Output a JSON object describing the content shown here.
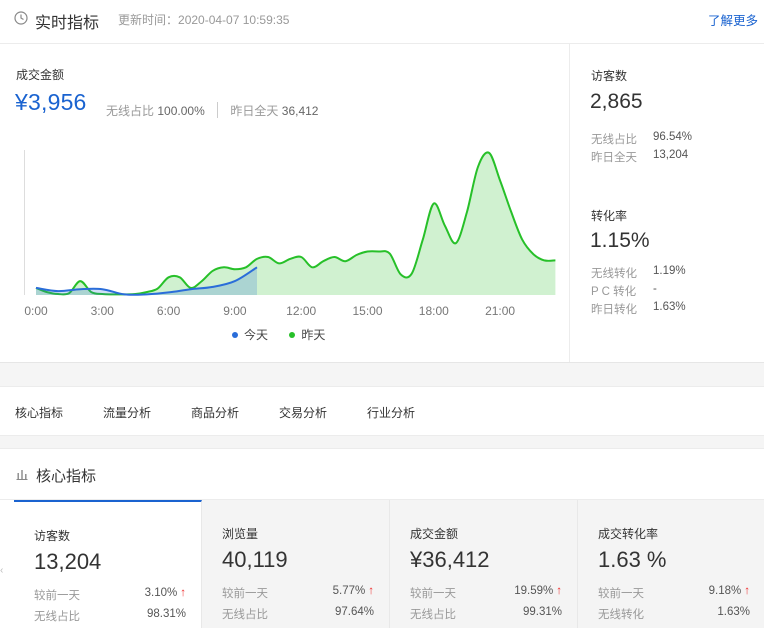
{
  "realtime": {
    "title": "实时指标",
    "update_label": "更新时间：",
    "update_time": "2020-04-07 10:59:35",
    "more_link": "了解更多",
    "gmv": {
      "label": "成交金额",
      "value": "¥3,956",
      "wireless_label": "无线占比",
      "wireless_value": "100.00%",
      "yesterday_label": "昨日全天",
      "yesterday_value": "36,412"
    },
    "visitors": {
      "label": "访客数",
      "value": "2,865",
      "rows": [
        {
          "label": "无线占比",
          "value": "96.54%"
        },
        {
          "label": "昨日全天",
          "value": "13,204"
        }
      ]
    },
    "conversion": {
      "label": "转化率",
      "value": "1.15%",
      "rows": [
        {
          "label": "无线转化",
          "value": "1.19%"
        },
        {
          "label": "P C 转化",
          "value": "-"
        },
        {
          "label": "昨日转化",
          "value": "1.63%"
        }
      ]
    }
  },
  "chart_data": {
    "type": "area",
    "x_ticks": [
      "0:00",
      "3:00",
      "6:00",
      "9:00",
      "12:00",
      "15:00",
      "18:00",
      "21:00"
    ],
    "ylim": [
      0,
      4500
    ],
    "grid": false,
    "legend_position": "bottom",
    "series": [
      {
        "name": "今天",
        "color": "#2a6dd9",
        "x": [
          0,
          1,
          2,
          3,
          4,
          5,
          6,
          7,
          8,
          9,
          10
        ],
        "y": [
          220,
          120,
          180,
          180,
          20,
          20,
          80,
          180,
          250,
          430,
          860
        ]
      },
      {
        "name": "昨天",
        "color": "#27c029",
        "x": [
          0,
          0.5,
          1,
          1.5,
          2,
          2.5,
          3,
          3.5,
          4,
          4.5,
          5,
          5.5,
          6,
          6.5,
          7,
          7.5,
          8,
          8.5,
          9,
          9.5,
          10,
          10.5,
          11,
          11.5,
          12,
          12.5,
          13,
          13.5,
          14,
          14.5,
          15,
          15.5,
          16,
          16.5,
          17,
          17.5,
          18,
          18.5,
          19,
          19.5,
          20,
          20.5,
          21,
          21.5,
          22,
          22.5,
          23,
          23.5
        ],
        "y": [
          220,
          90,
          30,
          60,
          430,
          90,
          30,
          20,
          20,
          30,
          90,
          200,
          550,
          550,
          220,
          430,
          750,
          860,
          800,
          860,
          1120,
          1180,
          980,
          1120,
          1180,
          860,
          1050,
          1180,
          1050,
          1240,
          1350,
          1350,
          1290,
          640,
          660,
          1720,
          2840,
          2150,
          1610,
          2580,
          3980,
          4410,
          3550,
          2580,
          1720,
          1270,
          1075,
          1075
        ]
      }
    ]
  },
  "tabs": [
    "核心指标",
    "流量分析",
    "商品分析",
    "交易分析",
    "行业分析"
  ],
  "core": {
    "title": "核心指标",
    "cards": [
      {
        "label": "访客数",
        "value": "13,204",
        "cmp_label": "较前一天",
        "cmp_value": "3.10%",
        "share_label": "无线占比",
        "share_value": "98.31%"
      },
      {
        "label": "浏览量",
        "value": "40,119",
        "cmp_label": "较前一天",
        "cmp_value": "5.77%",
        "share_label": "无线占比",
        "share_value": "97.64%"
      },
      {
        "label": "成交金额",
        "value": "¥36,412",
        "cmp_label": "较前一天",
        "cmp_value": "19.59%",
        "share_label": "无线占比",
        "share_value": "99.31%"
      },
      {
        "label": "成交转化率",
        "value": "1.63 %",
        "cmp_label": "较前一天",
        "cmp_value": "9.18%",
        "share_label": "无线转化",
        "share_value": "1.63%"
      }
    ],
    "up_arrow": "↑"
  },
  "icons": {
    "clock": "clock-icon",
    "bar": "bar-chart-icon",
    "arrow": "arrow-up-icon"
  },
  "colors": {
    "accent": "#1a63d0",
    "today": "#2a6dd9",
    "yesterday": "#27c029",
    "up": "#e33333"
  }
}
